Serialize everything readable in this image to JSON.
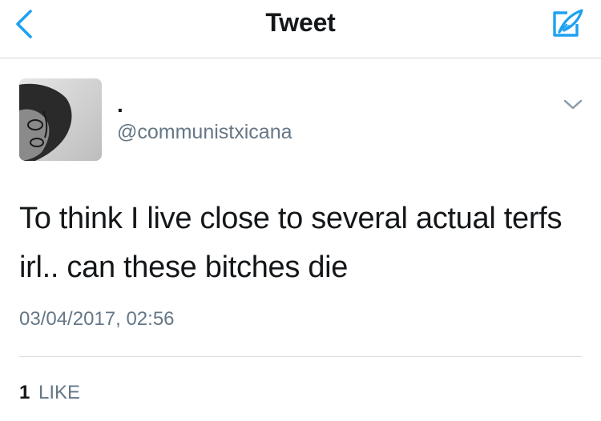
{
  "header": {
    "title": "Tweet",
    "back_icon": "chevron-left-icon",
    "compose_icon": "compose-feather-icon",
    "accent_color": "#1da1f2"
  },
  "tweet": {
    "display_name": ".",
    "handle": "@communistxicana",
    "text": "To think I live close to several actual terfs irl.. can these bitches die",
    "timestamp": "03/04/2017, 02:56",
    "likes_count": "1",
    "likes_label": "LIKE",
    "menu_icon": "chevron-down-icon"
  }
}
